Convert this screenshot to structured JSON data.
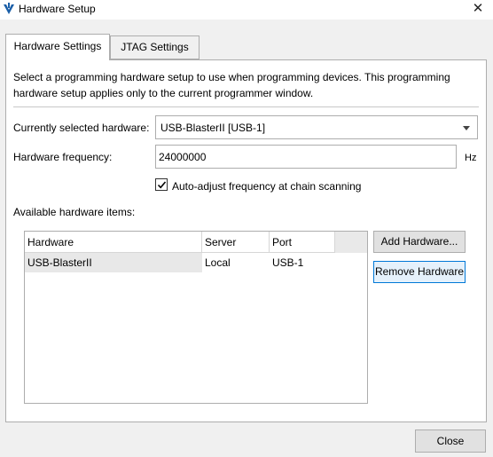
{
  "window": {
    "title": "Hardware Setup",
    "close_glyph": "✕",
    "app_icon": "quartus-icon"
  },
  "tabs": [
    {
      "label": "Hardware Settings",
      "active": true
    },
    {
      "label": "JTAG Settings",
      "active": false
    }
  ],
  "settings": {
    "description": "Select a programming hardware setup to use when programming devices. This programming hardware setup applies only to the current programmer window.",
    "selected_hardware_label": "Currently selected hardware:",
    "selected_hardware_value": "USB-BlasterII [USB-1]",
    "frequency_label": "Hardware frequency:",
    "frequency_value": "24000000",
    "frequency_unit": "Hz",
    "auto_adjust_label": "Auto-adjust frequency at chain scanning",
    "auto_adjust_checked": true,
    "available_label": "Available hardware items:"
  },
  "hardware_table": {
    "columns": [
      "Hardware",
      "Server",
      "Port"
    ],
    "rows": [
      [
        "USB-BlasterII",
        "Local",
        "USB-1"
      ]
    ]
  },
  "buttons": {
    "add": "Add Hardware...",
    "remove": "Remove Hardware",
    "close": "Close"
  },
  "colors": {
    "accent": "#0078d7",
    "icon_blue": "#1b5fa8"
  }
}
